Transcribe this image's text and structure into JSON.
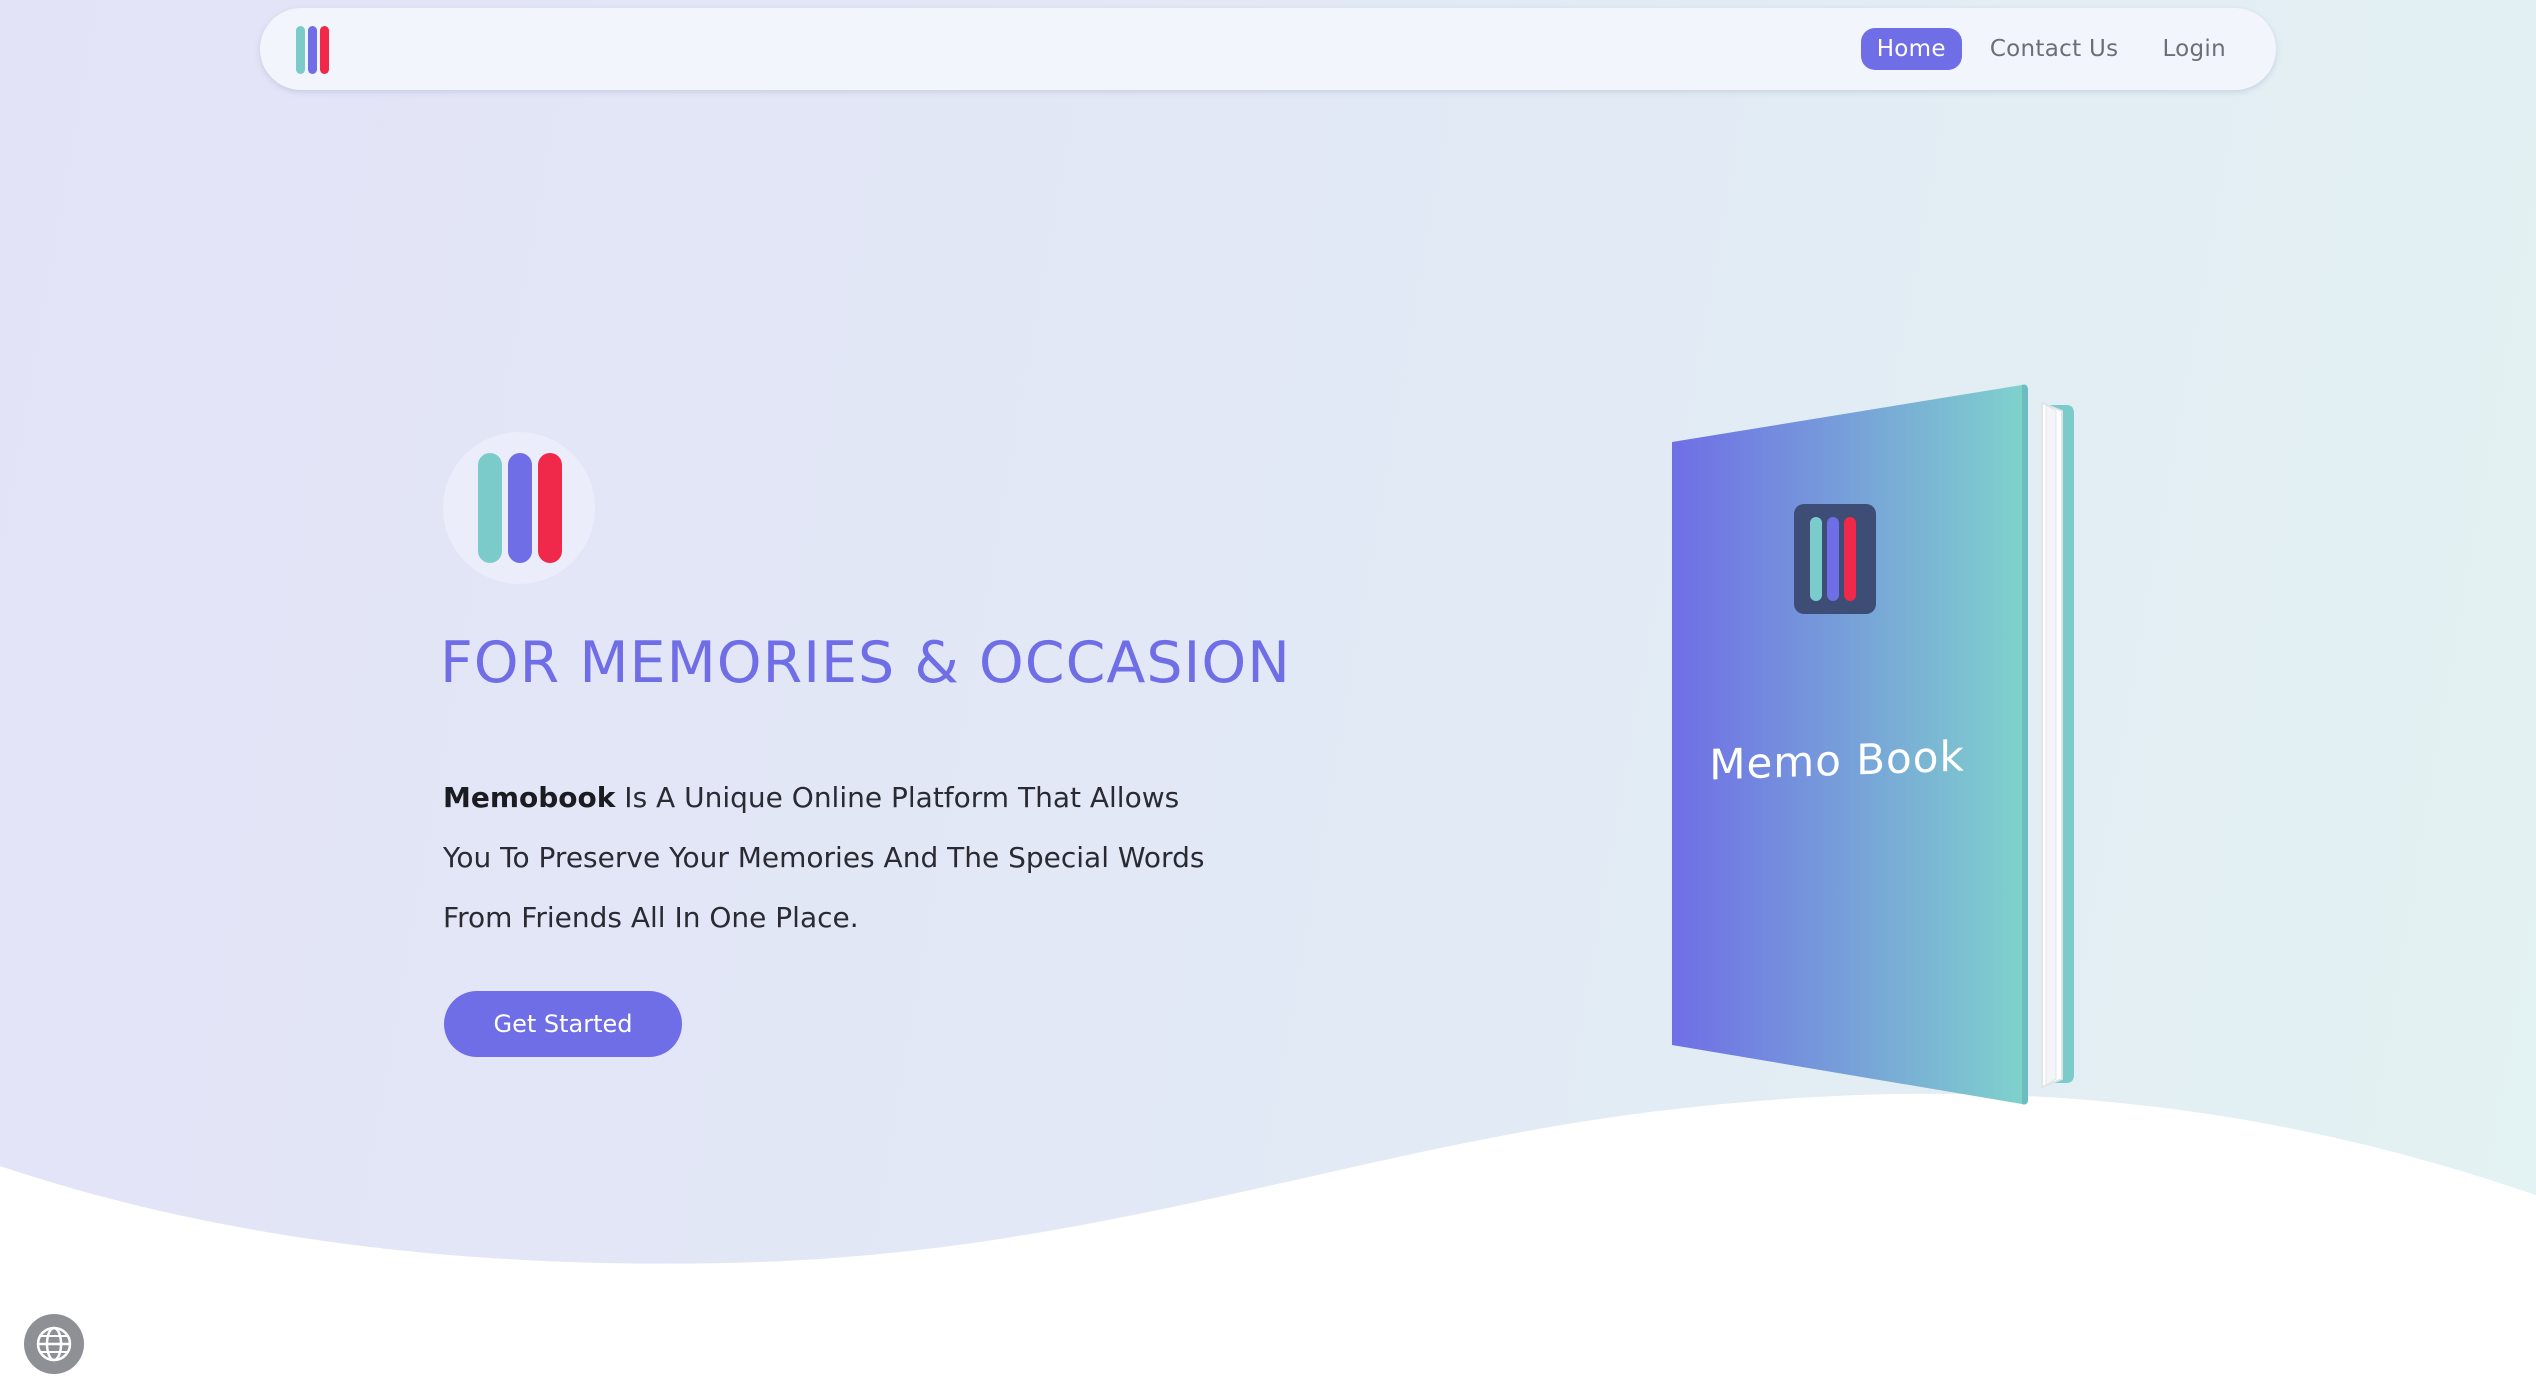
{
  "nav": {
    "links": [
      {
        "label": "Home",
        "active": true
      },
      {
        "label": "Contact Us",
        "active": false
      },
      {
        "label": "Login",
        "active": false
      }
    ]
  },
  "hero": {
    "title": "FOR MEMORIES & OCCASION",
    "description_brand": "Memobook",
    "description_line1": " Is A Unique Online Platform That Allows",
    "description_line2": "You To Preserve Your Memories And The Special Words",
    "description_line3": "From Friends All In One Place.",
    "cta_label": "Get Started"
  },
  "book": {
    "title": "Memo Book"
  },
  "colors": {
    "accent": "#6f6ee6",
    "teal": "#7ccbcb",
    "red": "#f0284a",
    "book_gradient_start": "#6f6ee6",
    "book_gradient_end": "#7fd3cc"
  },
  "icons": {
    "logo": "three-bars-logo-icon",
    "globe": "globe-icon"
  }
}
